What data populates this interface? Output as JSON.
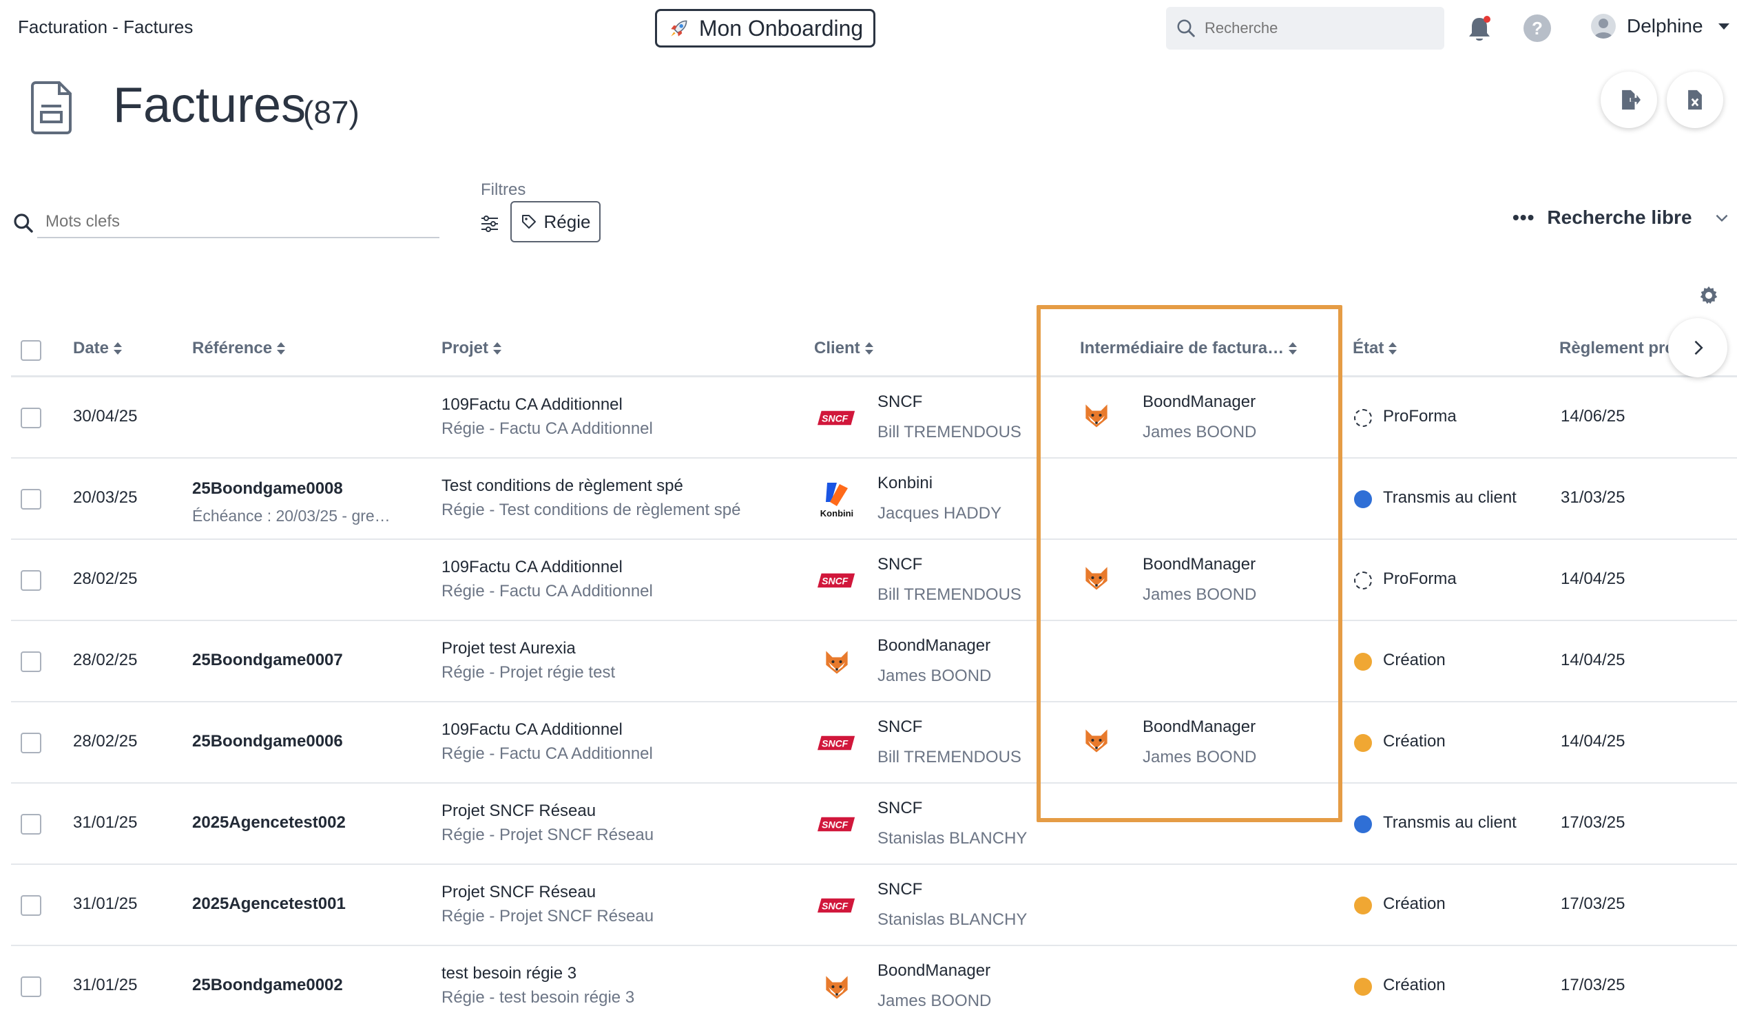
{
  "app": {
    "breadcrumb": "Facturation - Factures",
    "onboarding_label": "Mon Onboarding",
    "search_placeholder": "Recherche",
    "user_name": "Delphine"
  },
  "header": {
    "title": "Factures",
    "count": "(87)"
  },
  "filters": {
    "keywords_placeholder": "Mots clefs",
    "label": "Filtres",
    "chip_label": "Régie",
    "free_search_label": "Recherche libre"
  },
  "table": {
    "columns": {
      "date": "Date",
      "reference": "Référence",
      "projet": "Projet",
      "client": "Client",
      "intermediaire": "Intermédiaire de factura…",
      "etat": "État",
      "reglement": "Règlement pré"
    },
    "rows": [
      {
        "date": "30/04/25",
        "reference": "",
        "reference_sub": "",
        "projet": "109Factu CA Additionnel",
        "projet_sub": "Régie  - Factu CA Additionnel",
        "client_logo": "sncf-logo",
        "client": "SNCF",
        "client_contact": "Bill TREMENDOUS",
        "inter_logo": "fox-logo",
        "intermediaire": "BoondManager",
        "intermediaire_contact": "James BOOND",
        "state": "ProForma",
        "state_color": "dashed",
        "reglement": "14/06/25"
      },
      {
        "date": "20/03/25",
        "reference": "25Boondgame0008",
        "reference_sub": "Échéance : 20/03/25 - gre…",
        "projet": "Test conditions de règlement spé",
        "projet_sub": "Régie  - Test conditions de règlement spé",
        "client_logo": "konbini-logo",
        "client": "Konbini",
        "client_contact": "Jacques HADDY",
        "inter_logo": "",
        "intermediaire": "",
        "intermediaire_contact": "",
        "state": "Transmis au client",
        "state_color": "#2f6fd6",
        "reglement": "31/03/25"
      },
      {
        "date": "28/02/25",
        "reference": "",
        "reference_sub": "",
        "projet": "109Factu CA Additionnel",
        "projet_sub": "Régie  - Factu CA Additionnel",
        "client_logo": "sncf-logo",
        "client": "SNCF",
        "client_contact": "Bill TREMENDOUS",
        "inter_logo": "fox-logo",
        "intermediaire": "BoondManager",
        "intermediaire_contact": "James BOOND",
        "state": "ProForma",
        "state_color": "dashed",
        "reglement": "14/04/25"
      },
      {
        "date": "28/02/25",
        "reference": "25Boondgame0007",
        "reference_sub": "",
        "projet": "Projet test Aurexia",
        "projet_sub": "Régie  - Projet régie test",
        "client_logo": "fox-logo",
        "client": "BoondManager",
        "client_contact": "James BOOND",
        "inter_logo": "",
        "intermediaire": "",
        "intermediaire_contact": "",
        "state": "Création",
        "state_color": "#f0a733",
        "reglement": "14/04/25"
      },
      {
        "date": "28/02/25",
        "reference": "25Boondgame0006",
        "reference_sub": "",
        "projet": "109Factu CA Additionnel",
        "projet_sub": "Régie  - Factu CA Additionnel",
        "client_logo": "sncf-logo",
        "client": "SNCF",
        "client_contact": "Bill TREMENDOUS",
        "inter_logo": "fox-logo",
        "intermediaire": "BoondManager",
        "intermediaire_contact": "James BOOND",
        "state": "Création",
        "state_color": "#f0a733",
        "reglement": "14/04/25"
      },
      {
        "date": "31/01/25",
        "reference": "2025Agencetest002",
        "reference_sub": "",
        "projet": "Projet SNCF Réseau",
        "projet_sub": "Régie  - Projet SNCF Réseau",
        "client_logo": "sncf-logo",
        "client": "SNCF",
        "client_contact": "Stanislas BLANCHY",
        "inter_logo": "",
        "intermediaire": "",
        "intermediaire_contact": "",
        "state": "Transmis au client",
        "state_color": "#2f6fd6",
        "reglement": "17/03/25"
      },
      {
        "date": "31/01/25",
        "reference": "2025Agencetest001",
        "reference_sub": "",
        "projet": "Projet SNCF Réseau",
        "projet_sub": "Régie  - Projet SNCF Réseau",
        "client_logo": "sncf-logo",
        "client": "SNCF",
        "client_contact": "Stanislas BLANCHY",
        "inter_logo": "",
        "intermediaire": "",
        "intermediaire_contact": "",
        "state": "Création",
        "state_color": "#f0a733",
        "reglement": "17/03/25"
      },
      {
        "date": "31/01/25",
        "reference": "25Boondgame0002",
        "reference_sub": "",
        "projet": "test besoin régie 3",
        "projet_sub": "Régie  - test besoin régie 3",
        "client_logo": "fox-logo",
        "client": "BoondManager",
        "client_contact": "James BOOND",
        "inter_logo": "",
        "intermediaire": "",
        "intermediaire_contact": "",
        "state": "Création",
        "state_color": "#f0a733",
        "reglement": "17/03/25"
      }
    ]
  },
  "colors": {
    "accent_highlight": "#e59c45",
    "state_blue": "#2f6fd6",
    "state_orange": "#f0a733",
    "sncf_red": "#d1173b",
    "konbini_blue": "#1a55e3",
    "konbini_orange": "#ff6a1a"
  }
}
